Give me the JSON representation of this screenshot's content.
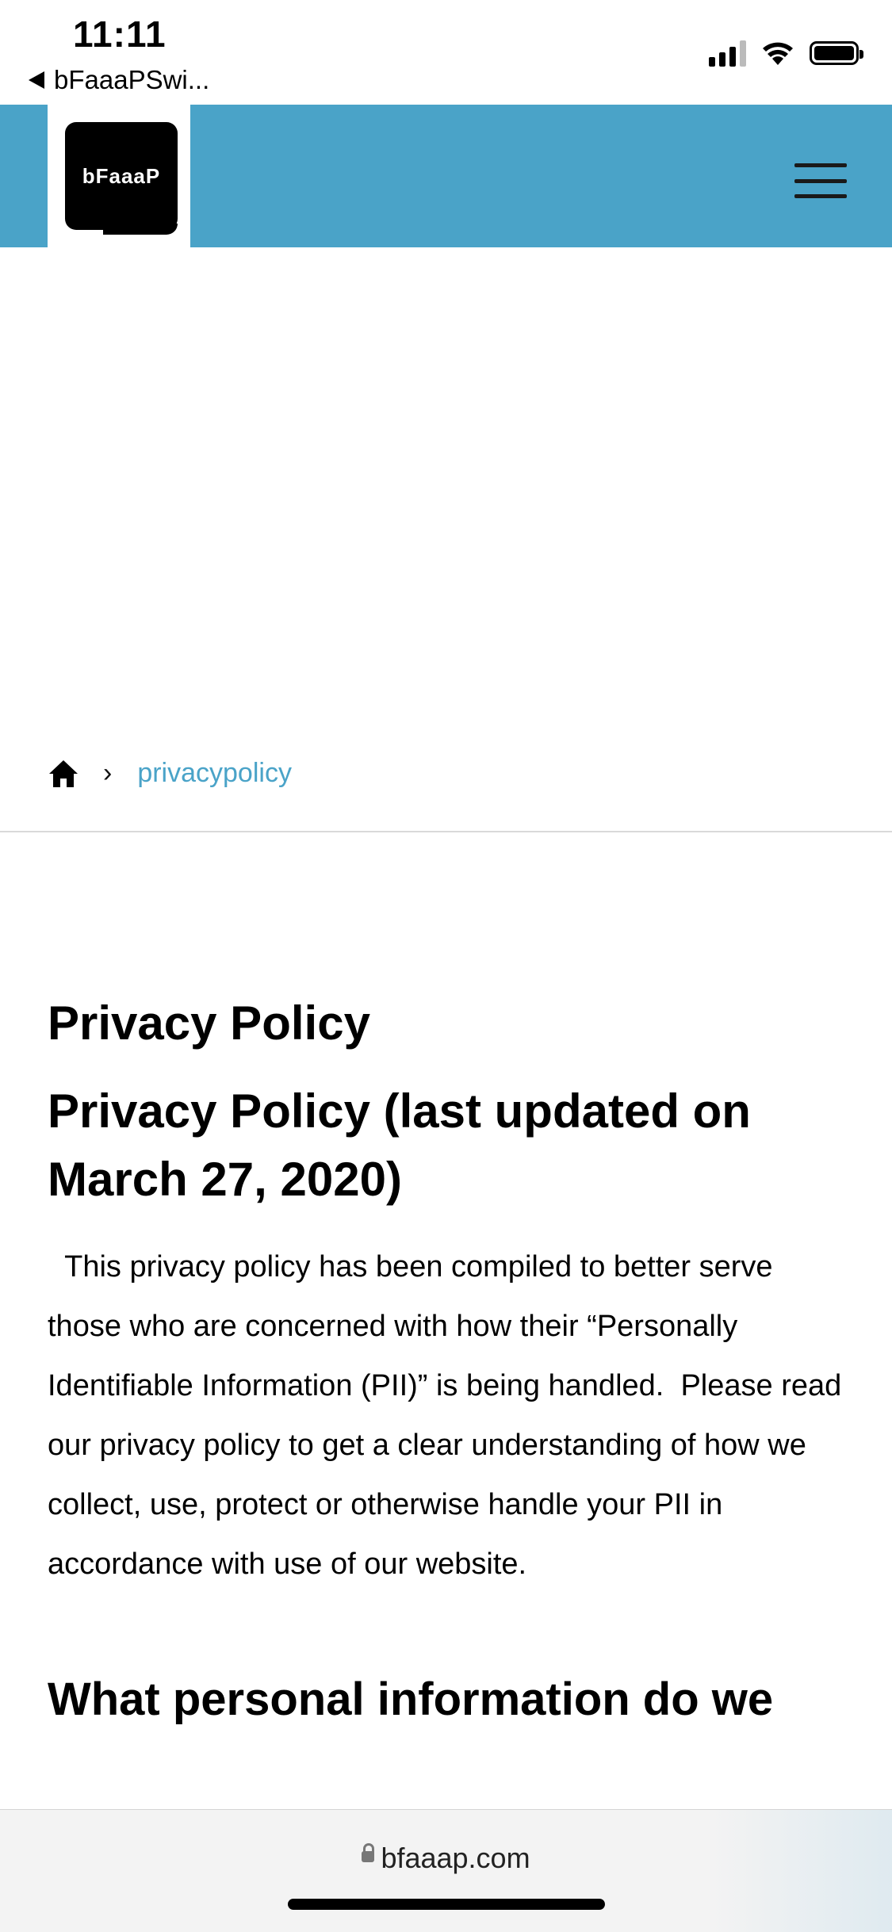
{
  "status_bar": {
    "time": "11:11",
    "back_app": "bFaaaPSwi..."
  },
  "header": {
    "logo_text": "bFaaaP",
    "menu_icon": "hamburger-menu-icon",
    "background_color": "#4aa3c8"
  },
  "breadcrumb": {
    "home_icon": "home-icon",
    "separator": "›",
    "current": "privacypolicy"
  },
  "content": {
    "title": "Privacy Policy",
    "subtitle": "Privacy Policy (last updated on March 27, 2020)",
    "intro": "  This privacy policy has been compiled to better serve those who are concerned with how their “Personally Identifiable Information (PII)” is being handled.  Please read our privacy policy to get a clear understanding of how we collect, use, protect or otherwise handle your PII in accordance with use of our website.",
    "next_heading": "What personal information do we"
  },
  "browser": {
    "url": "bfaaap.com"
  }
}
